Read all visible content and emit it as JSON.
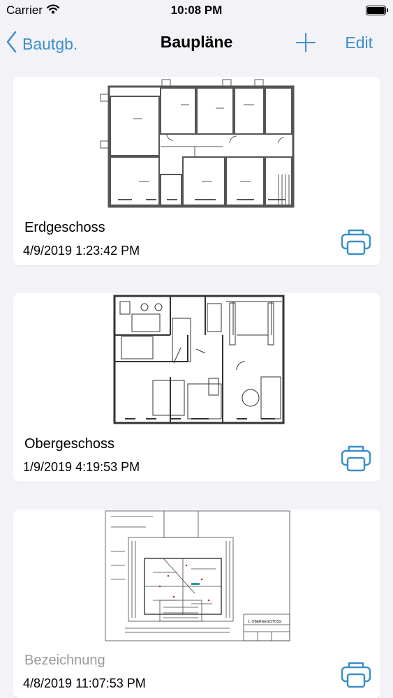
{
  "status_bar": {
    "carrier": "Carrier",
    "time": "10:08 PM"
  },
  "nav": {
    "back_label": "Bautgb.",
    "title": "Baupläne",
    "edit_label": "Edit"
  },
  "plans": [
    {
      "name": "Erdgeschoss",
      "date": "4/9/2019 1:23:42 PM",
      "name_is_placeholder": false
    },
    {
      "name": "Obergeschoss",
      "date": "1/9/2019 4:19:53 PM",
      "name_is_placeholder": false
    },
    {
      "name": "Bezeichnung",
      "date": "4/8/2019 11:07:53 PM",
      "name_is_placeholder": true,
      "drawing_stamp": "1. OBERGESCHOSS"
    }
  ],
  "colors": {
    "accent": "#3d8fc8",
    "background": "#f2f2f7",
    "card": "#ffffff"
  },
  "icons": {
    "back": "chevron-left-icon",
    "add": "plus-icon",
    "print": "printer-icon",
    "wifi": "wifi-icon",
    "battery": "battery-icon"
  }
}
